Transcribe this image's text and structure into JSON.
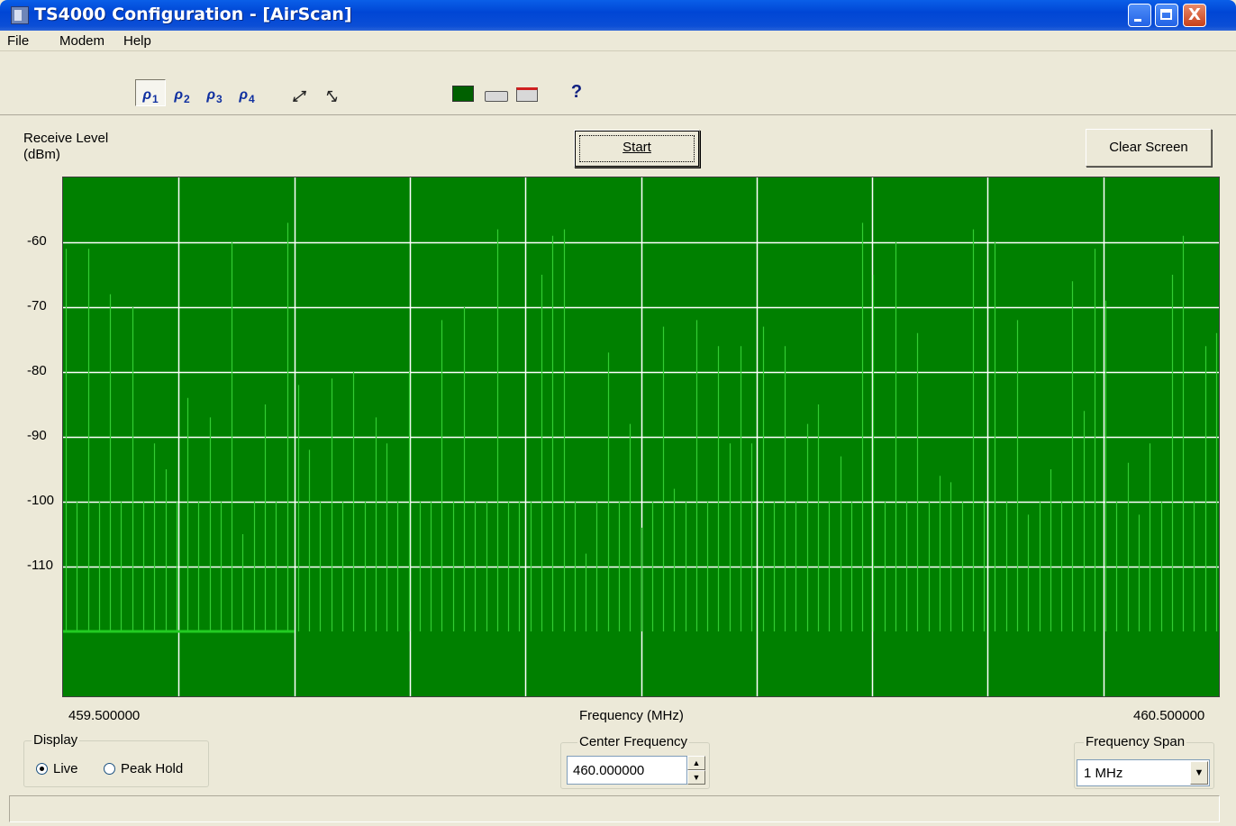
{
  "window": {
    "title": "TS4000 Configuration - [AirScan]",
    "close_glyph": "X"
  },
  "menu": [
    "File",
    "Modem",
    "Help"
  ],
  "toolbar": {
    "tools": [
      {
        "icon": "probe-1-icon",
        "label": "1"
      },
      {
        "icon": "probe-2-icon",
        "label": "2"
      },
      {
        "icon": "probe-3-icon",
        "label": "3"
      },
      {
        "icon": "probe-4-icon",
        "label": "4"
      },
      {
        "icon": "connect-icon",
        "label": ""
      },
      {
        "icon": "disconnect-icon",
        "label": ""
      },
      {
        "icon": "spectrum-icon",
        "label": ""
      },
      {
        "icon": "modem-icon",
        "label": ""
      },
      {
        "icon": "modem-alert-icon",
        "label": ""
      },
      {
        "icon": "help-icon",
        "label": "?"
      }
    ],
    "pressed_tool": "1"
  },
  "plot": {
    "y_axis_label": "Receive Level\n(dBm)",
    "start_label": "Start",
    "clear_label": "Clear Screen",
    "x_axis_label": "Frequency (MHz)",
    "x_start_label": "459.500000",
    "x_end_label": "460.500000"
  },
  "chart_data": {
    "type": "bar",
    "title": "",
    "xlabel": "Frequency (MHz)",
    "ylabel": "Receive Level (dBm)",
    "xlim": [
      459.5,
      460.5
    ],
    "ylim": [
      -130,
      -50
    ],
    "y_ticks": [
      -60,
      -70,
      -80,
      -90,
      -100,
      -110
    ],
    "x_gridlines": 10,
    "grid": true,
    "colors": {
      "background": "#008000",
      "grid": "#ffffff",
      "trace": "#33cc33"
    },
    "baseline_dbm": -120,
    "live_trace": {
      "x_end": 459.7,
      "value": -120
    },
    "values": [
      -61,
      -100,
      -61,
      -100,
      -68,
      -100,
      -70,
      -100,
      -91,
      -95,
      -100,
      -84,
      -100,
      -87,
      -100,
      -60,
      -105,
      -100,
      -85,
      -100,
      -57,
      -82,
      -92,
      -100,
      -81,
      -100,
      -80,
      -100,
      -87,
      -91,
      -100,
      -80,
      -100,
      -100,
      -72,
      -100,
      -70,
      -100,
      -100,
      -58,
      -100,
      -100,
      -100,
      -65,
      -59,
      -58,
      -100,
      -108,
      -100,
      -77,
      -100,
      -88,
      -104,
      -100,
      -73,
      -98,
      -100,
      -72,
      -100,
      -76,
      -91,
      -76,
      -91,
      -73,
      -100,
      -76,
      -100,
      -88,
      -85,
      -100,
      -93,
      -100,
      -57,
      -65,
      -100,
      -60,
      -100,
      -74,
      -100,
      -96,
      -97,
      -100,
      -58,
      -100,
      -60,
      -100,
      -72,
      -102,
      -100,
      -95,
      -100,
      -66,
      -86,
      -61,
      -69,
      -100,
      -94,
      -102,
      -91,
      -100,
      -65,
      -59,
      -100,
      -76,
      -74
    ]
  },
  "display_group": {
    "legend": "Display",
    "options": [
      {
        "label": "Live",
        "selected": true
      },
      {
        "label": "Peak Hold",
        "selected": false
      }
    ]
  },
  "center_frequency": {
    "legend": "Center Frequency",
    "value": "460.000000"
  },
  "frequency_span": {
    "legend": "Frequency Span",
    "value": "1 MHz"
  }
}
